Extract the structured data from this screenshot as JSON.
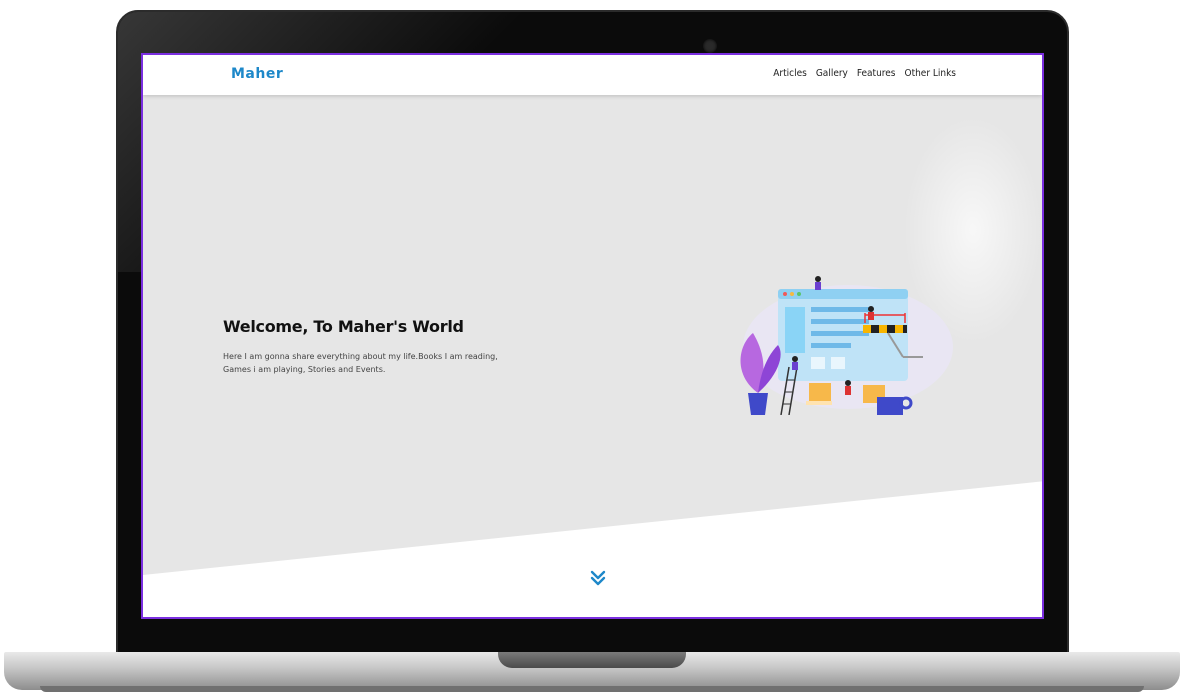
{
  "site": {
    "brand": "Maher",
    "nav": [
      "Articles",
      "Gallery",
      "Features",
      "Other Links"
    ]
  },
  "hero": {
    "title": "Welcome, To Maher's World",
    "text": "Here I am gonna share everything about my life.Books I am reading, Games i am playing, Stories and Events."
  },
  "icons": {
    "scroll": "double-chevron-down-icon",
    "illustration": "website-construction-illustration"
  },
  "colors": {
    "accent": "#1e88c9",
    "frame_border": "#7b2fe0",
    "hero_bg": "#e6e6e6"
  }
}
